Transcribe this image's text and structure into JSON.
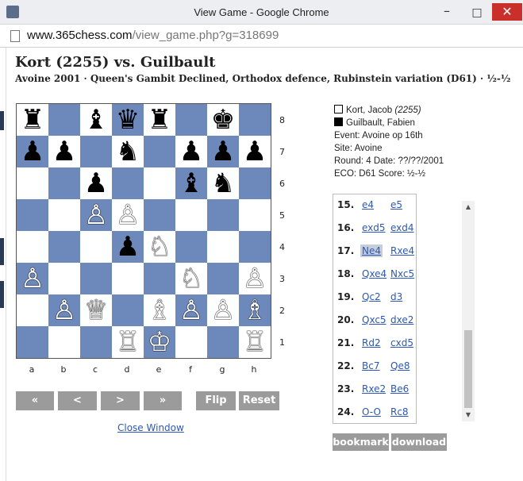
{
  "window": {
    "title": "View Game - Google Chrome",
    "minimize": "–",
    "maximize": "□",
    "close": "✕"
  },
  "urlbar": {
    "host": "www.365chess.com",
    "path": "/view_game.php?g=318699"
  },
  "heading": {
    "title": "Kort (2255) vs. Guilbault",
    "subtitle": "Avoine 2001 · Queen's Gambit Declined, Orthodox defence, Rubinstein variation (D61) · ½-½"
  },
  "board": {
    "ranks": [
      "8",
      "7",
      "6",
      "5",
      "4",
      "3",
      "2",
      "1"
    ],
    "files": [
      "a",
      "b",
      "c",
      "d",
      "e",
      "f",
      "g",
      "h"
    ],
    "pieces": [
      {
        "sq": "a8",
        "glyph": "♜",
        "color": "black"
      },
      {
        "sq": "c8",
        "glyph": "♝",
        "color": "black"
      },
      {
        "sq": "d8",
        "glyph": "♛",
        "color": "black"
      },
      {
        "sq": "e8",
        "glyph": "♜",
        "color": "black"
      },
      {
        "sq": "g8",
        "glyph": "♚",
        "color": "black"
      },
      {
        "sq": "a7",
        "glyph": "♟",
        "color": "black"
      },
      {
        "sq": "b7",
        "glyph": "♟",
        "color": "black"
      },
      {
        "sq": "d7",
        "glyph": "♞",
        "color": "black"
      },
      {
        "sq": "f7",
        "glyph": "♟",
        "color": "black"
      },
      {
        "sq": "g7",
        "glyph": "♟",
        "color": "black"
      },
      {
        "sq": "h7",
        "glyph": "♟",
        "color": "black"
      },
      {
        "sq": "c6",
        "glyph": "♟",
        "color": "black"
      },
      {
        "sq": "f6",
        "glyph": "♝",
        "color": "black"
      },
      {
        "sq": "g6",
        "glyph": "♞",
        "color": "black"
      },
      {
        "sq": "c5",
        "glyph": "♙",
        "color": "white"
      },
      {
        "sq": "d5",
        "glyph": "♙",
        "color": "white"
      },
      {
        "sq": "d4",
        "glyph": "♟",
        "color": "black"
      },
      {
        "sq": "e4",
        "glyph": "♘",
        "color": "white"
      },
      {
        "sq": "a3",
        "glyph": "♙",
        "color": "white"
      },
      {
        "sq": "f3",
        "glyph": "♘",
        "color": "white"
      },
      {
        "sq": "h3",
        "glyph": "♙",
        "color": "white"
      },
      {
        "sq": "b2",
        "glyph": "♙",
        "color": "white"
      },
      {
        "sq": "c2",
        "glyph": "♕",
        "color": "white"
      },
      {
        "sq": "e2",
        "glyph": "♗",
        "color": "white"
      },
      {
        "sq": "f2",
        "glyph": "♙",
        "color": "white"
      },
      {
        "sq": "g2",
        "glyph": "♙",
        "color": "white"
      },
      {
        "sq": "h2",
        "glyph": "♗",
        "color": "white"
      },
      {
        "sq": "d1",
        "glyph": "♖",
        "color": "white"
      },
      {
        "sq": "e1",
        "glyph": "♔",
        "color": "white"
      },
      {
        "sq": "h1",
        "glyph": "♖",
        "color": "white"
      }
    ],
    "dark_color": "#6d89bb",
    "light_color": "#ffffff"
  },
  "nav": {
    "first": "«",
    "prev": "<",
    "next": ">",
    "last": "»",
    "flip": "Flip",
    "reset": "Reset",
    "close_window": "Close Window"
  },
  "info": {
    "white_player": "Kort, Jacob",
    "white_rating": "(2255)",
    "black_player": "Guilbault, Fabien",
    "event": "Event: Avoine op 16th",
    "site": "Site: Avoine",
    "round": "Round: 4  Date: ??/??/2001",
    "eco": "ECO: D61 Score: ½-½"
  },
  "moves": [
    {
      "num": "15.",
      "w": "e4",
      "b": "e5"
    },
    {
      "num": "16.",
      "w": "exd5",
      "b": "exd4"
    },
    {
      "num": "17.",
      "w": "Ne4",
      "b": "Rxe4",
      "current": "w"
    },
    {
      "num": "18.",
      "w": "Qxe4",
      "b": "Nxc5"
    },
    {
      "num": "19.",
      "w": "Qc2",
      "b": "d3"
    },
    {
      "num": "20.",
      "w": "Qxc5",
      "b": "dxe2"
    },
    {
      "num": "21.",
      "w": "Rd2",
      "b": "cxd5"
    },
    {
      "num": "22.",
      "w": "Bc7",
      "b": "Qe8"
    },
    {
      "num": "23.",
      "w": "Rxe2",
      "b": "Be6"
    },
    {
      "num": "24.",
      "w": "O-O",
      "b": "Rc8"
    }
  ],
  "actions": {
    "bookmark": "bookmark",
    "download": "download"
  },
  "scroll": {
    "up": "▲",
    "down": "▼"
  }
}
